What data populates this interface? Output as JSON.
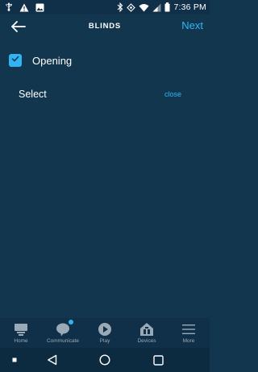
{
  "status_bar": {
    "time": "7:36 PM",
    "icons_left": [
      "usb-icon",
      "alert-icon",
      "image-icon"
    ],
    "icons_right": [
      "bluetooth-icon",
      "nfc-icon",
      "wifi-icon",
      "signal-icon",
      "battery-icon"
    ]
  },
  "header": {
    "back_icon": "arrow-left-icon",
    "title": "BLINDS",
    "next_label": "Next"
  },
  "option": {
    "label": "Opening",
    "checked": true
  },
  "select": {
    "label": "Select",
    "close_label": "close"
  },
  "tab_bar": {
    "tabs": [
      {
        "label": "Home",
        "icon": "home-icon"
      },
      {
        "label": "Communicate",
        "icon": "chat-bubble-icon",
        "badge": true
      },
      {
        "label": "Play",
        "icon": "play-icon"
      },
      {
        "label": "Devices",
        "icon": "devices-icon"
      },
      {
        "label": "More",
        "icon": "menu-icon"
      }
    ]
  },
  "nav_bar": {
    "items": [
      "square-dot-icon",
      "back-triangle-icon",
      "home-circle-icon",
      "recents-square-icon"
    ]
  },
  "colors": {
    "background": "#13364f",
    "accent": "#2fb5f3",
    "bar": "#0f3048"
  }
}
